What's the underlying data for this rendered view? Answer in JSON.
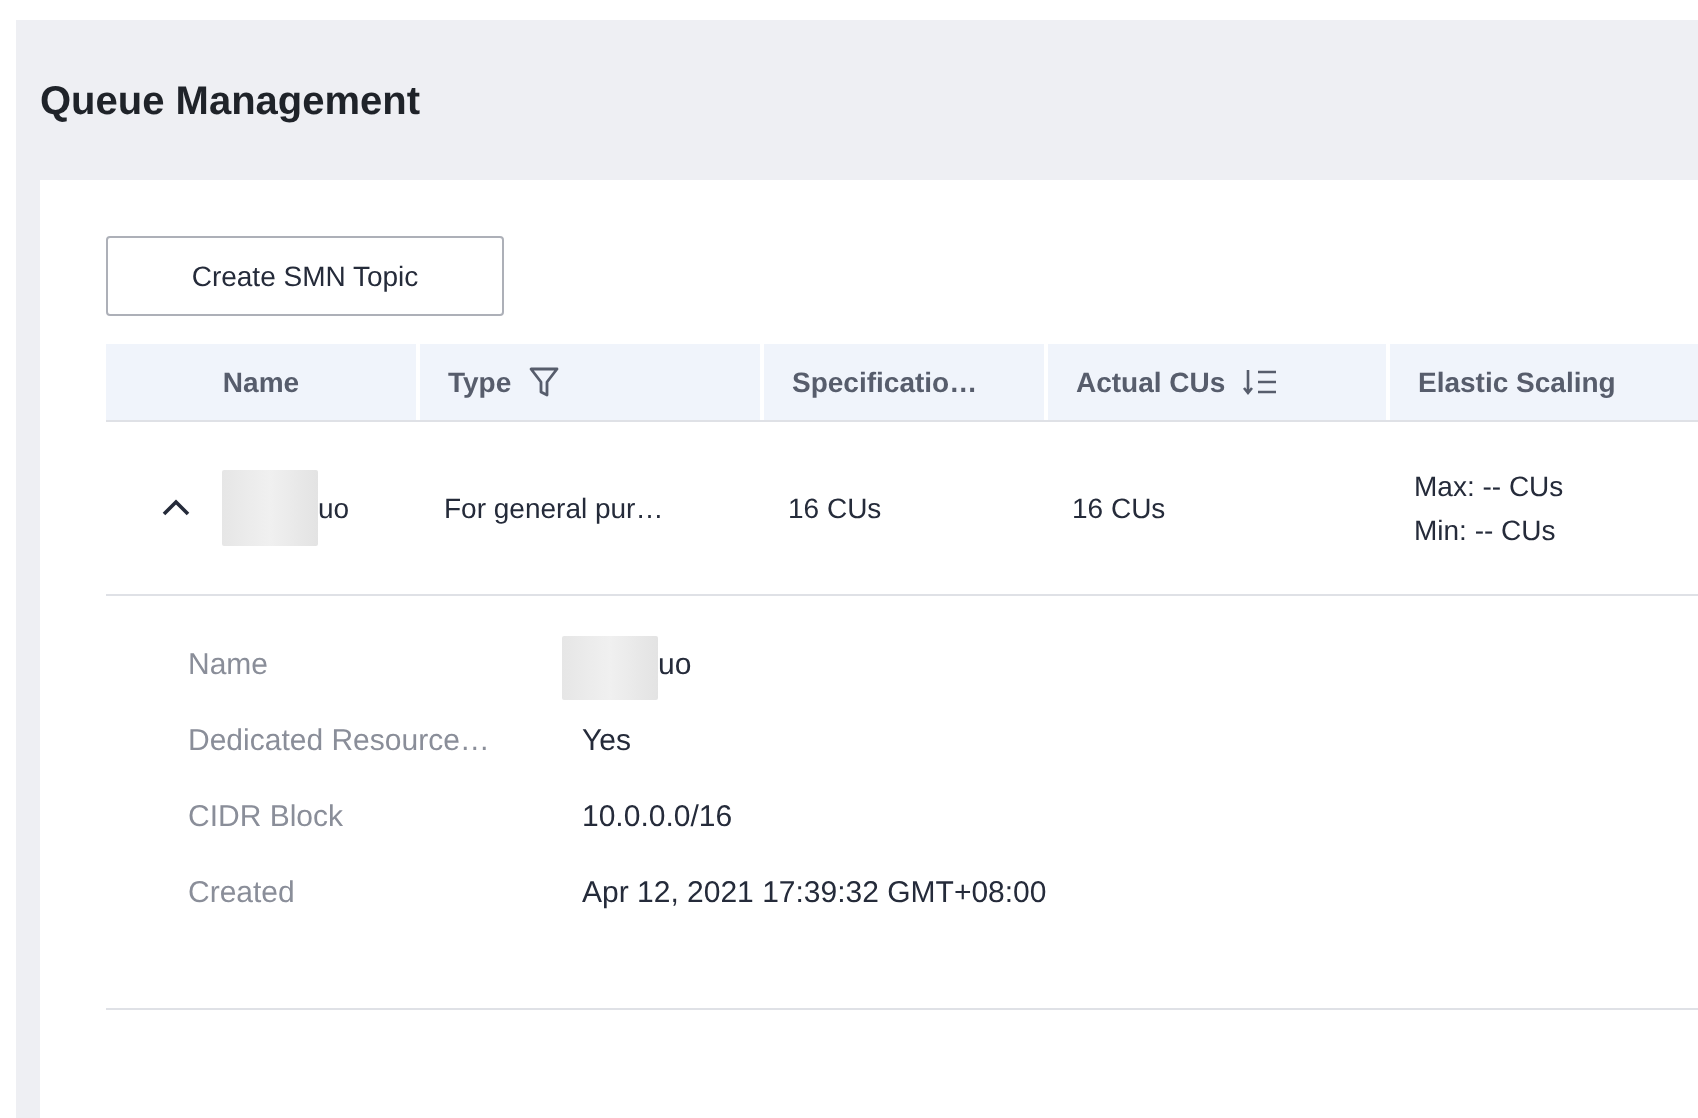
{
  "page": {
    "title": "Queue Management"
  },
  "toolbar": {
    "button": "Create SMN Topic"
  },
  "table": {
    "columns": [
      {
        "label": "Name",
        "kind": "plain"
      },
      {
        "label": "Type",
        "kind": "filter"
      },
      {
        "label": "Specificatio…",
        "kind": "plain"
      },
      {
        "label": "Actual CUs",
        "kind": "sort"
      },
      {
        "label": "Elastic Scaling",
        "kind": "plain"
      }
    ],
    "rows": [
      {
        "expanded": true,
        "name": "uo",
        "type": "For general pur…",
        "specification": "16 CUs",
        "actual_cus": "16 CUs",
        "scaling": [
          "Max: -- CUs",
          "Min: -- CUs"
        ],
        "details": [
          {
            "label": "Name",
            "value": "uo",
            "redacted": true
          },
          {
            "label": "Dedicated Resource…",
            "value": "Yes",
            "redacted": false
          },
          {
            "label": "CIDR Block",
            "value": "10.0.0.0/16",
            "redacted": false
          },
          {
            "label": "Created",
            "value": "Apr 12, 2021 17:39:32 GMT+08:00",
            "redacted": false
          }
        ]
      }
    ]
  }
}
